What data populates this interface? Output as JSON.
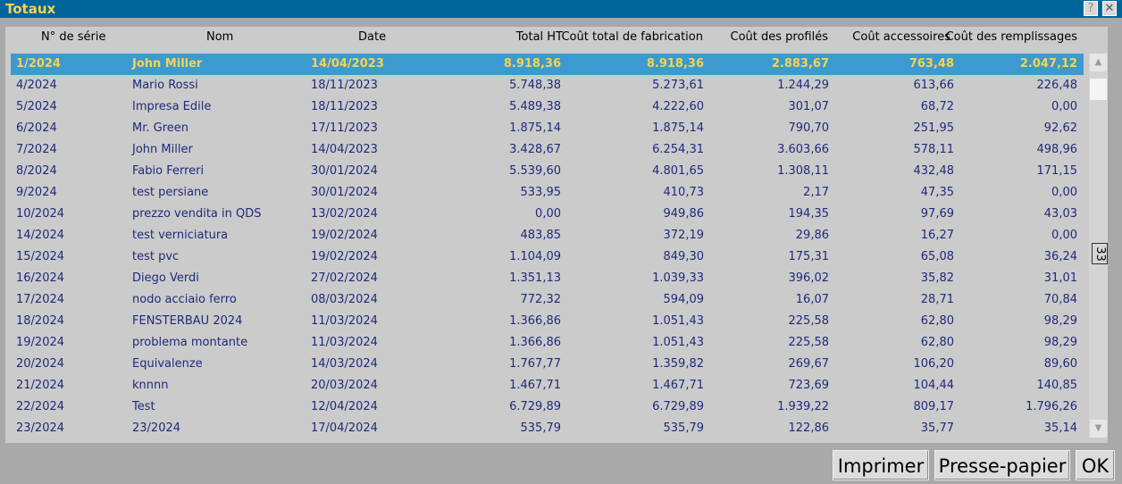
{
  "window": {
    "title": "Totaux",
    "help_label": "?",
    "close_label": "✕"
  },
  "columns": {
    "num": "N° de série",
    "nom": "Nom",
    "date": "Date",
    "total_ht": "Total HT",
    "cout_fab": "Coût total de fabrication",
    "cout_prof": "Coût des profilés",
    "cout_acc": "Coût accessoires",
    "cout_rem": "Coût des remplissages"
  },
  "rows": [
    {
      "num": "1/2024",
      "nom": "John Miller",
      "date": "14/04/2023",
      "ht": "8.918,36",
      "fab": "8.918,36",
      "prof": "2.883,67",
      "acc": "763,48",
      "rem": "2.047,12"
    },
    {
      "num": "4/2024",
      "nom": "Mario Rossi",
      "date": "18/11/2023",
      "ht": "5.748,38",
      "fab": "5.273,61",
      "prof": "1.244,29",
      "acc": "613,66",
      "rem": "226,48"
    },
    {
      "num": "5/2024",
      "nom": "Impresa Edile",
      "date": "18/11/2023",
      "ht": "5.489,38",
      "fab": "4.222,60",
      "prof": "301,07",
      "acc": "68,72",
      "rem": "0,00"
    },
    {
      "num": "6/2024",
      "nom": "Mr. Green",
      "date": "17/11/2023",
      "ht": "1.875,14",
      "fab": "1.875,14",
      "prof": "790,70",
      "acc": "251,95",
      "rem": "92,62"
    },
    {
      "num": "7/2024",
      "nom": "John Miller",
      "date": "14/04/2023",
      "ht": "3.428,67",
      "fab": "6.254,31",
      "prof": "3.603,66",
      "acc": "578,11",
      "rem": "498,96"
    },
    {
      "num": "8/2024",
      "nom": "Fabio Ferreri",
      "date": "30/01/2024",
      "ht": "5.539,60",
      "fab": "4.801,65",
      "prof": "1.308,11",
      "acc": "432,48",
      "rem": "171,15"
    },
    {
      "num": "9/2024",
      "nom": "test persiane",
      "date": "30/01/2024",
      "ht": "533,95",
      "fab": "410,73",
      "prof": "2,17",
      "acc": "47,35",
      "rem": "0,00"
    },
    {
      "num": "10/2024",
      "nom": "prezzo vendita in QDS",
      "date": "13/02/2024",
      "ht": "0,00",
      "fab": "949,86",
      "prof": "194,35",
      "acc": "97,69",
      "rem": "43,03"
    },
    {
      "num": "14/2024",
      "nom": "test verniciatura",
      "date": "19/02/2024",
      "ht": "483,85",
      "fab": "372,19",
      "prof": "29,86",
      "acc": "16,27",
      "rem": "0,00"
    },
    {
      "num": "15/2024",
      "nom": "test pvc",
      "date": "19/02/2024",
      "ht": "1.104,09",
      "fab": "849,30",
      "prof": "175,31",
      "acc": "65,08",
      "rem": "36,24"
    },
    {
      "num": "16/2024",
      "nom": "Diego Verdi",
      "date": "27/02/2024",
      "ht": "1.351,13",
      "fab": "1.039,33",
      "prof": "396,02",
      "acc": "35,82",
      "rem": "31,01"
    },
    {
      "num": "17/2024",
      "nom": "nodo acciaio ferro",
      "date": "08/03/2024",
      "ht": "772,32",
      "fab": "594,09",
      "prof": "16,07",
      "acc": "28,71",
      "rem": "70,84"
    },
    {
      "num": "18/2024",
      "nom": "FENSTERBAU 2024",
      "date": "11/03/2024",
      "ht": "1.366,86",
      "fab": "1.051,43",
      "prof": "225,58",
      "acc": "62,80",
      "rem": "98,29"
    },
    {
      "num": "19/2024",
      "nom": "problema montante",
      "date": "11/03/2024",
      "ht": "1.366,86",
      "fab": "1.051,43",
      "prof": "225,58",
      "acc": "62,80",
      "rem": "98,29"
    },
    {
      "num": "20/2024",
      "nom": "Equivalenze",
      "date": "14/03/2024",
      "ht": "1.767,77",
      "fab": "1.359,82",
      "prof": "269,67",
      "acc": "106,20",
      "rem": "89,60"
    },
    {
      "num": "21/2024",
      "nom": "knnnn",
      "date": "20/03/2024",
      "ht": "1.467,71",
      "fab": "1.467,71",
      "prof": "723,69",
      "acc": "104,44",
      "rem": "140,85"
    },
    {
      "num": "22/2024",
      "nom": "Test",
      "date": "12/04/2024",
      "ht": "6.729,89",
      "fab": "6.729,89",
      "prof": "1.939,22",
      "acc": "809,17",
      "rem": "1.796,26"
    },
    {
      "num": "23/2024",
      "nom": "23/2024",
      "date": "17/04/2024",
      "ht": "535,79",
      "fab": "535,79",
      "prof": "122,86",
      "acc": "35,77",
      "rem": "35,14"
    }
  ],
  "selected_row": 0,
  "row_count": "33",
  "scrollbar": {
    "up": "▲",
    "down": "▼"
  },
  "buttons": {
    "print": "Imprimer",
    "clipboard": "Presse-papier",
    "ok": "OK"
  },
  "colors": {
    "titlebar": "#00659a",
    "title_text": "#ffd24a",
    "selection": "#3b9ad0",
    "row_text": "#1e2b7a"
  }
}
